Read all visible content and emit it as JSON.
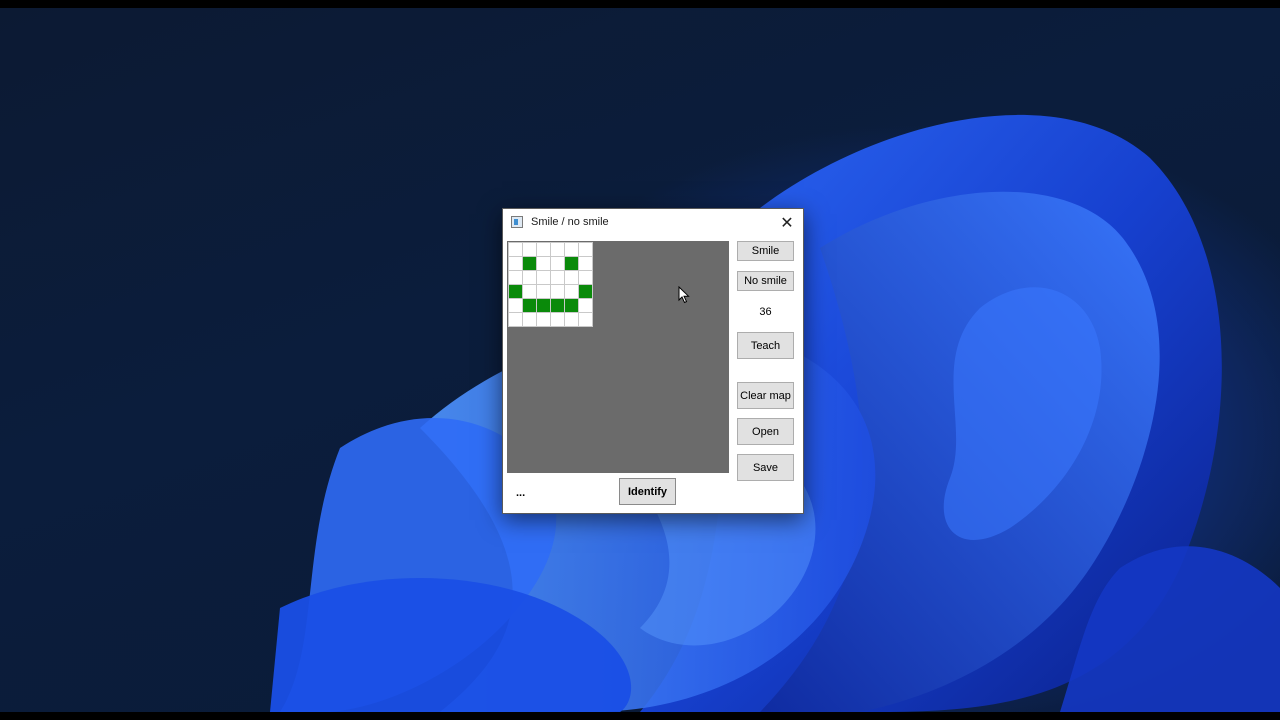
{
  "window": {
    "title": "Smile / no smile",
    "close_glyph": "✕"
  },
  "canvas": {
    "background": "#6b6b6b",
    "grid_rows": 6,
    "grid_cols": 6,
    "active_color": "#0a8a0a",
    "cells": [
      [
        0,
        0,
        0,
        0,
        0,
        0
      ],
      [
        0,
        1,
        0,
        0,
        1,
        0
      ],
      [
        0,
        0,
        0,
        0,
        0,
        0
      ],
      [
        1,
        0,
        0,
        0,
        0,
        1
      ],
      [
        0,
        1,
        1,
        1,
        1,
        0
      ],
      [
        0,
        0,
        0,
        0,
        0,
        0
      ]
    ]
  },
  "buttons": {
    "smile": "Smile",
    "no_smile": "No smile",
    "teach": "Teach",
    "clear_map": "Clear map",
    "open": "Open",
    "save": "Save",
    "identify": "Identify"
  },
  "counter": "36",
  "status": "...",
  "icons": {
    "app": "app-icon",
    "close": "close-icon",
    "cursor": "mouse-cursor-icon"
  }
}
